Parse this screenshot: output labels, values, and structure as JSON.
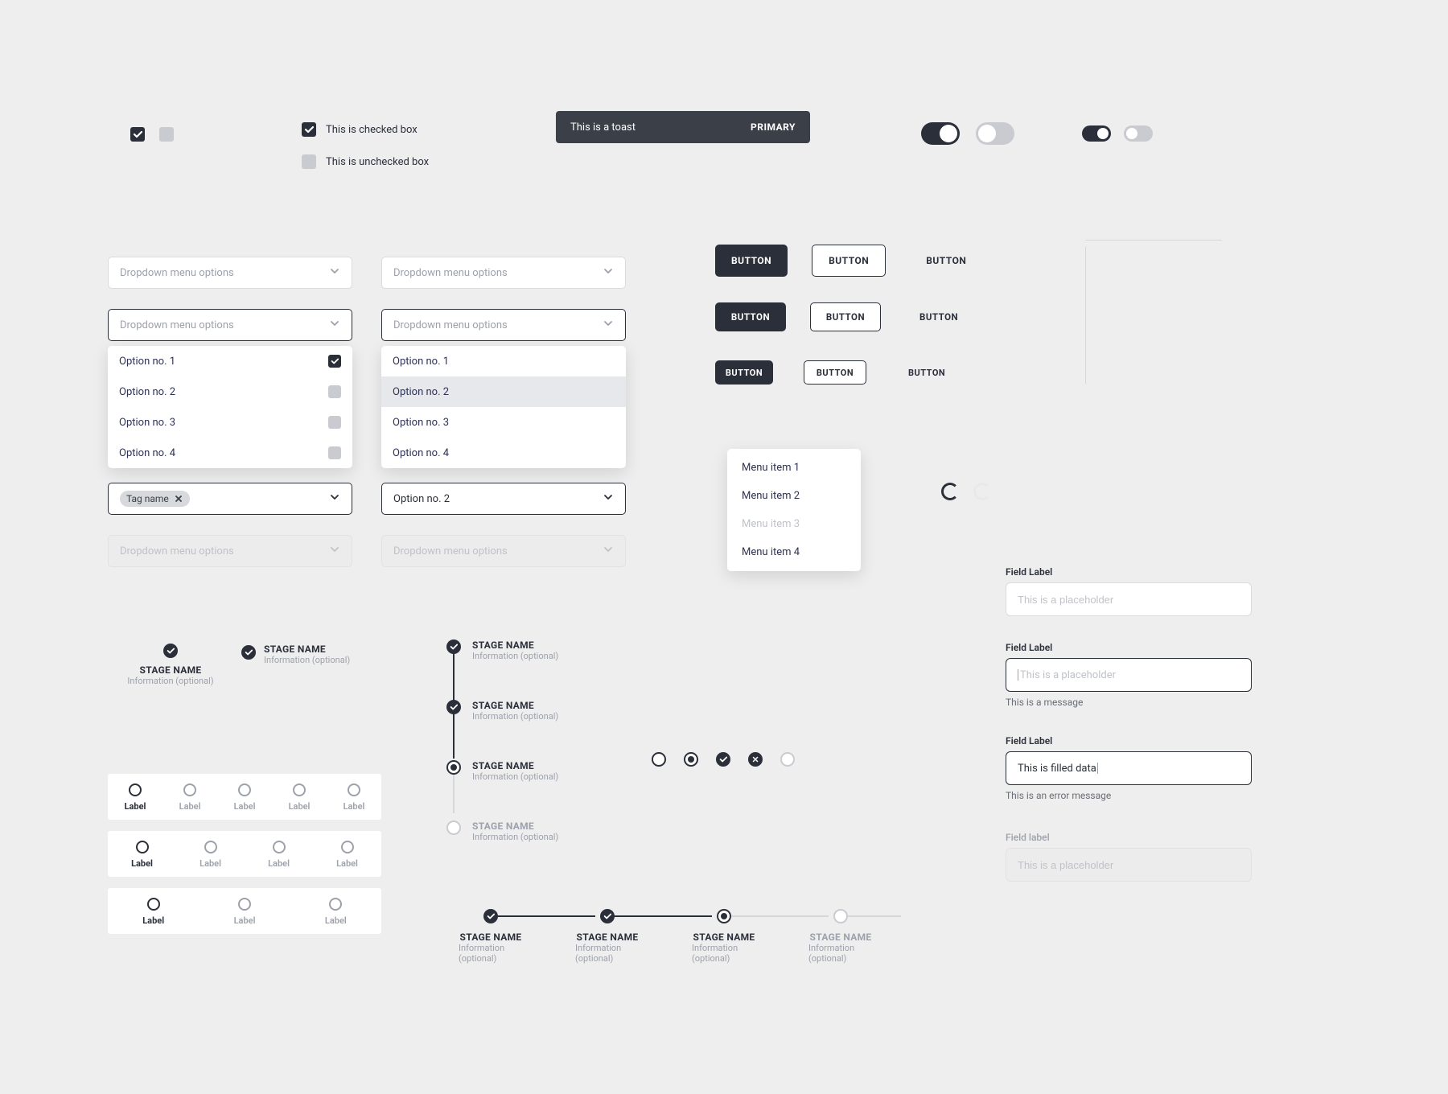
{
  "checkboxes": {
    "labeled_checked": "This is checked box",
    "labeled_unchecked": "This is unchecked box"
  },
  "toast": {
    "message": "This is a toast",
    "action": "PRIMARY"
  },
  "dropdowns": {
    "placeholder": "Dropdown menu options",
    "options": [
      "Option no. 1",
      "Option no. 2",
      "Option no. 3",
      "Option no. 4"
    ],
    "tag_name": "Tag name",
    "selected_value": "Option no. 2"
  },
  "buttons": {
    "label": "BUTTON"
  },
  "menu": {
    "items": [
      "Menu item 1",
      "Menu item 2",
      "Menu item 3",
      "Menu item 4"
    ],
    "disabled_index": 2
  },
  "stepper": {
    "stage_label": "STAGE NAME",
    "info": "Information (optional)"
  },
  "radios": {
    "label": "Label"
  },
  "fields": {
    "label": "Field Label",
    "label_disabled": "Field label",
    "placeholder": "This is a placeholder",
    "message": "This is a message",
    "filled_value": "This is filled data",
    "error_message": "This is an error message"
  }
}
